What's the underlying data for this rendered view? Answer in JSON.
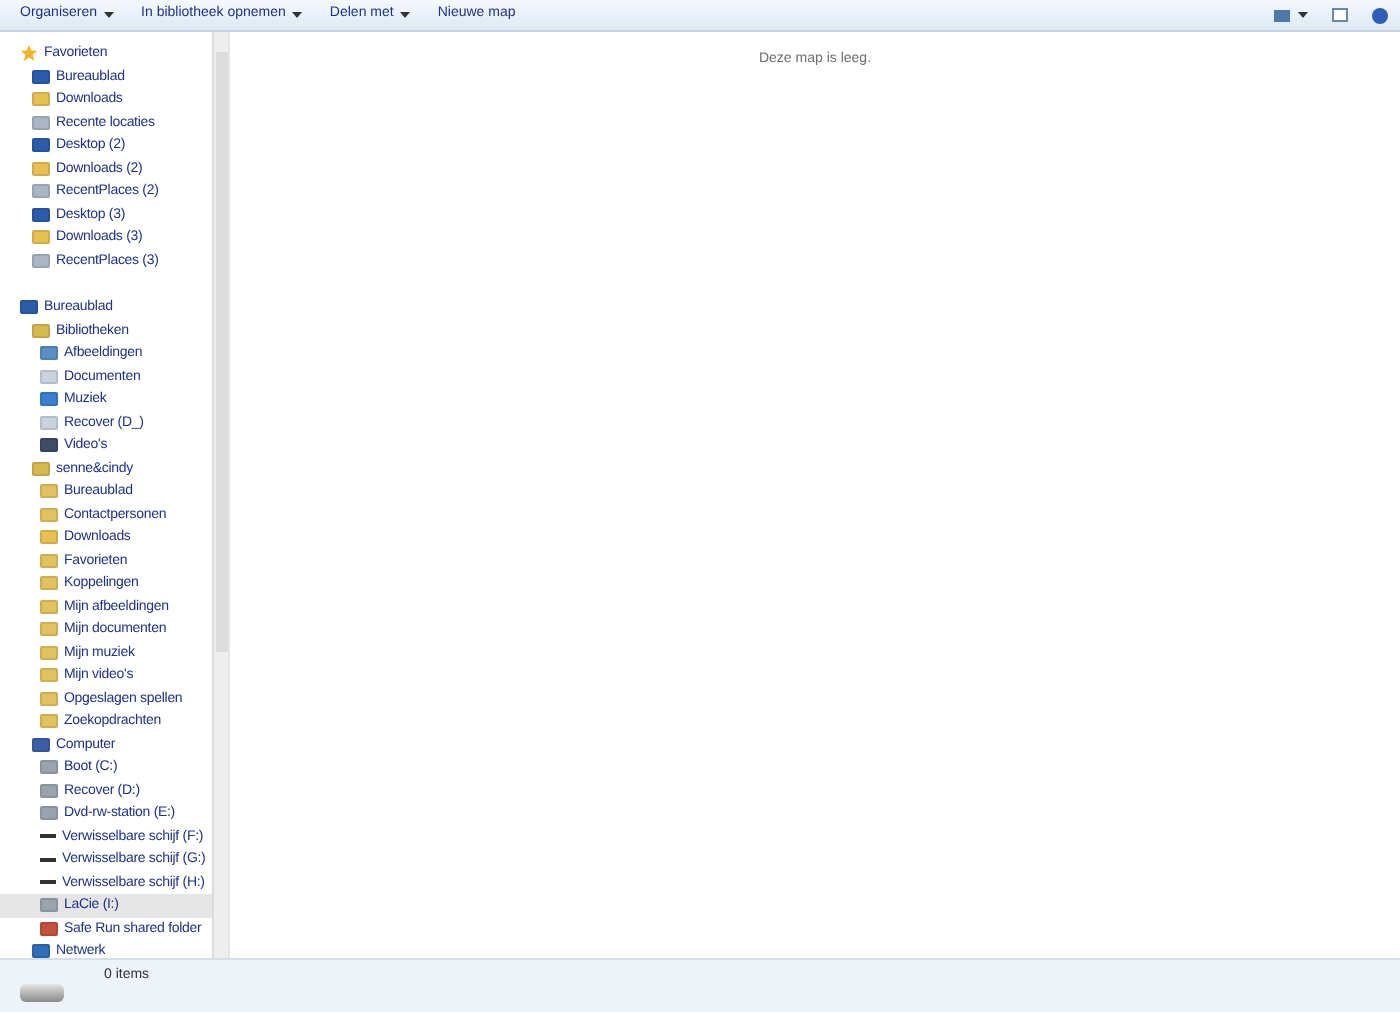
{
  "toolbar": {
    "buttons": [
      {
        "label": "Organiseren",
        "dropdown": true
      },
      {
        "label": "In bibliotheek opnemen",
        "dropdown": true
      },
      {
        "label": "Delen met",
        "dropdown": true
      },
      {
        "label": "Nieuwe map",
        "dropdown": false
      }
    ]
  },
  "navigation": {
    "groups": [
      {
        "label": "Favorieten",
        "kind": "star",
        "selected": false,
        "children": [
          {
            "label": "Bureaublad",
            "kind": "desktop",
            "selected": false
          },
          {
            "label": "Downloads",
            "kind": "download",
            "selected": false
          },
          {
            "label": "Recente locaties",
            "kind": "places",
            "selected": false
          },
          {
            "label": "Desktop (2)",
            "kind": "desktop",
            "selected": false
          },
          {
            "label": "Downloads (2)",
            "kind": "download",
            "selected": false
          },
          {
            "label": "RecentPlaces (2)",
            "kind": "places",
            "selected": false
          },
          {
            "label": "Desktop (3)",
            "kind": "desktop",
            "selected": false
          },
          {
            "label": "Downloads (3)",
            "kind": "download",
            "selected": false
          },
          {
            "label": "RecentPlaces (3)",
            "kind": "places",
            "selected": false
          }
        ]
      },
      {
        "label": "Bureaublad",
        "kind": "desktop",
        "selected": false,
        "children": [
          {
            "label": "Bibliotheken",
            "kind": "library",
            "selected": false,
            "children": [
              {
                "label": "Afbeeldingen",
                "kind": "picture",
                "selected": false
              },
              {
                "label": "Documenten",
                "kind": "document",
                "selected": false
              },
              {
                "label": "Muziek",
                "kind": "music",
                "selected": false
              },
              {
                "label": "Recover (D_)",
                "kind": "document",
                "selected": false
              },
              {
                "label": "Video's",
                "kind": "video",
                "selected": false
              }
            ]
          },
          {
            "label": "senne&cindy",
            "kind": "user",
            "selected": false,
            "children": [
              {
                "label": "Bureaublad",
                "kind": "folder",
                "selected": false
              },
              {
                "label": "Contactpersonen",
                "kind": "folder",
                "selected": false
              },
              {
                "label": "Downloads",
                "kind": "download",
                "selected": false
              },
              {
                "label": "Favorieten",
                "kind": "folder",
                "selected": false
              },
              {
                "label": "Koppelingen",
                "kind": "folder",
                "selected": false
              },
              {
                "label": "Mijn afbeeldingen",
                "kind": "folder",
                "selected": false
              },
              {
                "label": "Mijn documenten",
                "kind": "folder",
                "selected": false
              },
              {
                "label": "Mijn muziek",
                "kind": "folder",
                "selected": false
              },
              {
                "label": "Mijn video's",
                "kind": "folder",
                "selected": false
              },
              {
                "label": "Opgeslagen spellen",
                "kind": "folder",
                "selected": false
              },
              {
                "label": "Zoekopdrachten",
                "kind": "folder",
                "selected": false
              }
            ]
          },
          {
            "label": "Computer",
            "kind": "computer",
            "selected": false,
            "children": [
              {
                "label": "Boot (C:)",
                "kind": "drive",
                "selected": false
              },
              {
                "label": "Recover (D:)",
                "kind": "drive",
                "selected": false
              },
              {
                "label": "Dvd-rw-station (E:)",
                "kind": "drive",
                "selected": false
              },
              {
                "label": "Verwisselbare schijf (F:)",
                "kind": "removable",
                "selected": false
              },
              {
                "label": "Verwisselbare schijf (G:)",
                "kind": "removable",
                "selected": false
              },
              {
                "label": "Verwisselbare schijf (H:)",
                "kind": "removable",
                "selected": false
              },
              {
                "label": "LaCie (I:)",
                "kind": "drive",
                "selected": true
              },
              {
                "label": "Safe Run shared folder",
                "kind": "shared",
                "selected": false
              }
            ]
          },
          {
            "label": "Netwerk",
            "kind": "network",
            "selected": false
          }
        ]
      }
    ]
  },
  "content": {
    "empty_message": "Deze map is leeg."
  },
  "status_bar": {
    "count": "0 items"
  }
}
